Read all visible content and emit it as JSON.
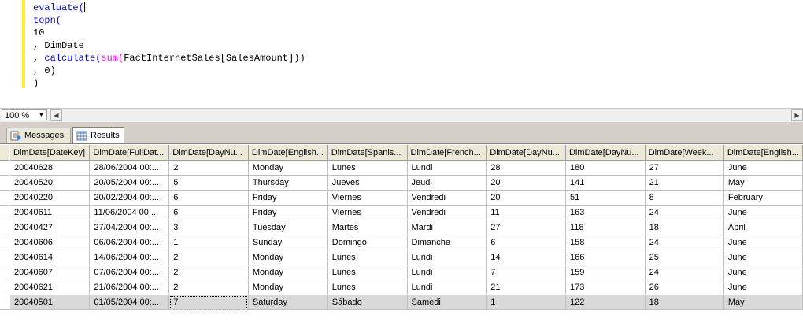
{
  "editor": {
    "lines": [
      {
        "parts": [
          {
            "t": "evaluate(",
            "c": "kw"
          }
        ],
        "caret": true
      },
      {
        "parts": [
          {
            "t": "topn(",
            "c": "kw"
          }
        ]
      },
      {
        "parts": [
          {
            "t": "10",
            "c": ""
          }
        ]
      },
      {
        "parts": [
          {
            "t": ", DimDate",
            "c": ""
          }
        ]
      },
      {
        "parts": [
          {
            "t": ", ",
            "c": ""
          },
          {
            "t": "calculate(",
            "c": "kw"
          },
          {
            "t": "sum(",
            "c": "fn"
          },
          {
            "t": "FactInternetSales[SalesAmount]))",
            "c": ""
          }
        ]
      },
      {
        "parts": [
          {
            "t": ", 0)",
            "c": ""
          }
        ]
      },
      {
        "parts": [
          {
            "t": ")",
            "c": ""
          }
        ]
      }
    ]
  },
  "zoom": {
    "value": "100 %"
  },
  "tabs": {
    "messages": "Messages",
    "results": "Results"
  },
  "grid": {
    "columns": [
      "DimDate[DateKey]",
      "DimDate[FullDat...",
      "DimDate[DayNu...",
      "DimDate[English...",
      "DimDate[Spanis...",
      "DimDate[French...",
      "DimDate[DayNu...",
      "DimDate[DayNu...",
      "DimDate[Week...",
      "DimDate[English..."
    ],
    "rows": [
      [
        "20040628",
        "28/06/2004 00:...",
        "2",
        "Monday",
        "Lunes",
        "Lundi",
        "28",
        "180",
        "27",
        "June"
      ],
      [
        "20040520",
        "20/05/2004 00:...",
        "5",
        "Thursday",
        "Jueves",
        "Jeudi",
        "20",
        "141",
        "21",
        "May"
      ],
      [
        "20040220",
        "20/02/2004 00:...",
        "6",
        "Friday",
        "Viernes",
        "Vendredi",
        "20",
        "51",
        "8",
        "February"
      ],
      [
        "20040611",
        "11/06/2004 00:...",
        "6",
        "Friday",
        "Viernes",
        "Vendredi",
        "11",
        "163",
        "24",
        "June"
      ],
      [
        "20040427",
        "27/04/2004 00:...",
        "3",
        "Tuesday",
        "Martes",
        "Mardi",
        "27",
        "118",
        "18",
        "April"
      ],
      [
        "20040606",
        "06/06/2004 00:...",
        "1",
        "Sunday",
        "Domingo",
        "Dimanche",
        "6",
        "158",
        "24",
        "June"
      ],
      [
        "20040614",
        "14/06/2004 00:...",
        "2",
        "Monday",
        "Lunes",
        "Lundi",
        "14",
        "166",
        "25",
        "June"
      ],
      [
        "20040607",
        "07/06/2004 00:...",
        "2",
        "Monday",
        "Lunes",
        "Lundi",
        "7",
        "159",
        "24",
        "June"
      ],
      [
        "20040621",
        "21/06/2004 00:...",
        "2",
        "Monday",
        "Lunes",
        "Lundi",
        "21",
        "173",
        "26",
        "June"
      ],
      [
        "20040501",
        "01/05/2004 00:...",
        "7",
        "Saturday",
        "Sábado",
        "Samedi",
        "1",
        "122",
        "18",
        "May"
      ]
    ],
    "selected_row": 9
  }
}
